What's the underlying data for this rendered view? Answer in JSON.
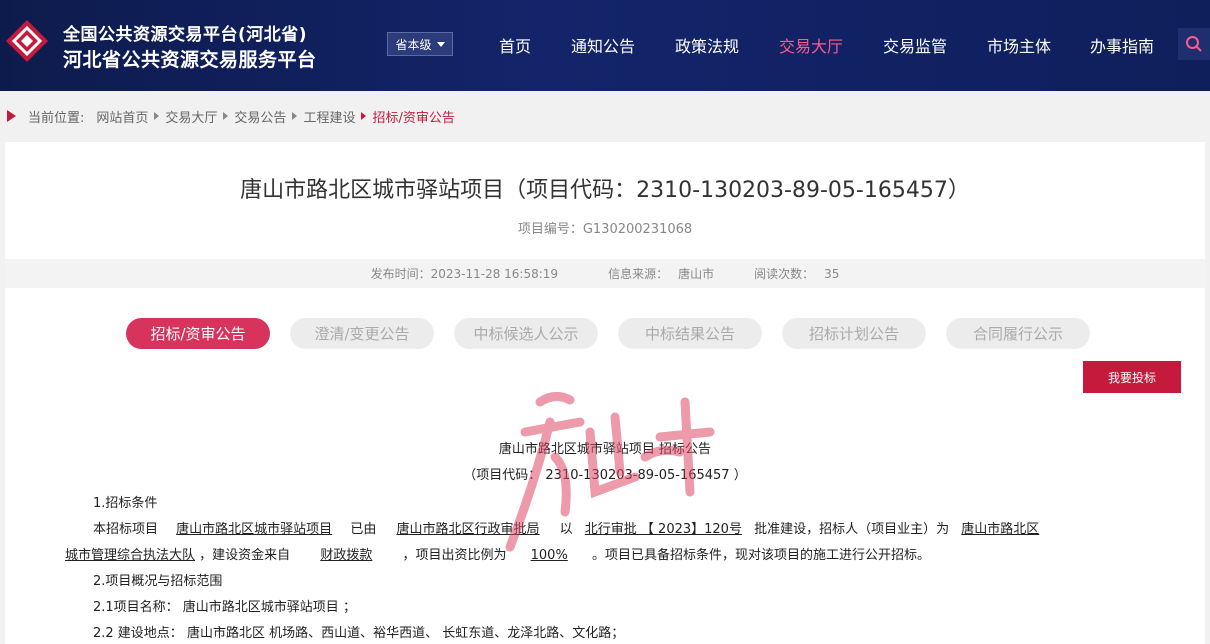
{
  "header": {
    "brand_line1": "全国公共资源交易平台(河北省)",
    "brand_line2": "河北省公共资源交易服务平台",
    "level_select": "省本级",
    "nav": [
      {
        "label": "首页",
        "active": false
      },
      {
        "label": "通知公告",
        "active": false
      },
      {
        "label": "政策法规",
        "active": false
      },
      {
        "label": "交易大厅",
        "active": true
      },
      {
        "label": "交易监管",
        "active": false
      },
      {
        "label": "市场主体",
        "active": false
      },
      {
        "label": "办事指南",
        "active": false
      }
    ],
    "accent_color": "#ff5a8c"
  },
  "breadcrumb": {
    "prefix": "当前位置:",
    "items": [
      "网站首页",
      "交易大厅",
      "交易公告",
      "工程建设"
    ],
    "current": "招标/资审公告"
  },
  "article": {
    "title": "唐山市路北区城市驿站项目（项目代码：2310-130203-89-05-165457）",
    "project_no": "项目编号：G130200231068",
    "publish_time": "发布时间：2023-11-28 16:58:19",
    "source_label": "信息来源：",
    "source": "唐山市",
    "views_label": "阅读次数：",
    "views": "35"
  },
  "tabs": [
    {
      "label": "招标/资审公告",
      "active": true
    },
    {
      "label": "澄清/变更公告",
      "active": false
    },
    {
      "label": "中标候选人公示",
      "active": false
    },
    {
      "label": "中标结果公告",
      "active": false
    },
    {
      "label": "招标计划公告",
      "active": false
    },
    {
      "label": "合同履行公示",
      "active": false
    }
  ],
  "bid_button": "我要投标",
  "document": {
    "heading": "唐山市路北区城市驿站项目 招标公告",
    "code_line": "（项目代码： 2310-130203-89-05-165457 ）",
    "s1_title": "1.招标条件",
    "p1_a": "本招标项目",
    "p1_project": "唐山市路北区城市驿站项目",
    "p1_b": "已由",
    "p1_approver": "唐山市路北区行政审批局",
    "p1_c": "以",
    "p1_doc": "北行审批 【 2023】120号",
    "p1_d": "批准建设，招标人（项目业主）为",
    "p1_owner1": "唐山市路北区",
    "p1_owner2": "城市管理综合执法大队",
    "p1_e": "，建设资金来自",
    "p1_fund": "财政拨款",
    "p1_f": "，项目出资比例为",
    "p1_ratio": "100%",
    "p1_g": "。项目已具备招标条件，现对该项目的施工进行公开招标。",
    "s2_title": "2.项目概况与招标范围",
    "s21": "2.1项目名称： 唐山市路北区城市驿站项目 ；",
    "s22": "2.2 建设地点： 唐山市路北区 机场路、西山道、裕华西道、 长虹东道、龙泽北路、文化路；"
  }
}
